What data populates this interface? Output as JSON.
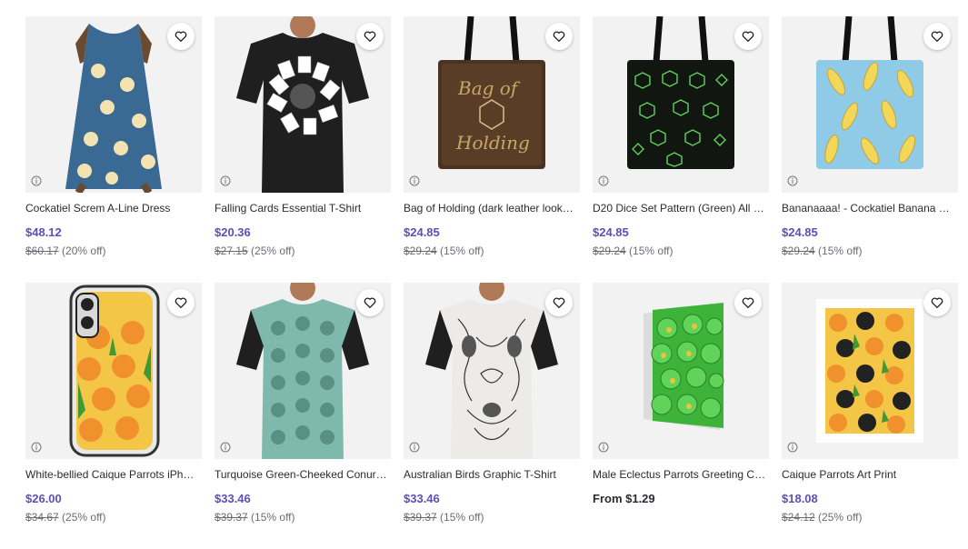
{
  "products": [
    {
      "title": "Cockatiel Screm A-Line Dress",
      "price": "$48.12",
      "was": "$60.17",
      "discount": "(20% off)",
      "image_icon": "dress-image"
    },
    {
      "title": "Falling Cards Essential T-Shirt",
      "price": "$20.36",
      "was": "$27.15",
      "discount": "(25% off)",
      "image_icon": "tshirt-image"
    },
    {
      "title": "Bag of Holding (dark leather look…",
      "price": "$24.85",
      "was": "$29.24",
      "discount": "(15% off)",
      "image_icon": "tote-bag-image"
    },
    {
      "title": "D20 Dice Set Pattern (Green) All …",
      "price": "$24.85",
      "was": "$29.24",
      "discount": "(15% off)",
      "image_icon": "tote-bag-image"
    },
    {
      "title": "Bananaaaa! - Cockatiel Banana P…",
      "price": "$24.85",
      "was": "$29.24",
      "discount": "(15% off)",
      "image_icon": "tote-bag-image"
    },
    {
      "title": "White-bellied Caique Parrots iPh…",
      "price": "$26.00",
      "was": "$34.67",
      "discount": "(25% off)",
      "image_icon": "phone-case-image"
    },
    {
      "title": "Turquoise Green-Cheeked Conur…",
      "price": "$33.46",
      "was": "$39.37",
      "discount": "(15% off)",
      "image_icon": "tshirt-image"
    },
    {
      "title": "Australian Birds Graphic T-Shirt",
      "price": "$33.46",
      "was": "$39.37",
      "discount": "(15% off)",
      "image_icon": "tshirt-image"
    },
    {
      "title": "Male Eclectus Parrots Greeting C…",
      "price": "From $1.29",
      "was": "",
      "discount": "",
      "image_icon": "greeting-card-image"
    },
    {
      "title": "Caique Parrots Art Print",
      "price": "$18.08",
      "was": "$24.12",
      "discount": "(25% off)",
      "image_icon": "art-print-image"
    }
  ],
  "colors": {
    "price_accent": "#5b50b7",
    "thumb_bg": "#f2f2f2"
  },
  "icons": {
    "favorite": "heart-outline-icon",
    "info": "info-circle-icon"
  }
}
